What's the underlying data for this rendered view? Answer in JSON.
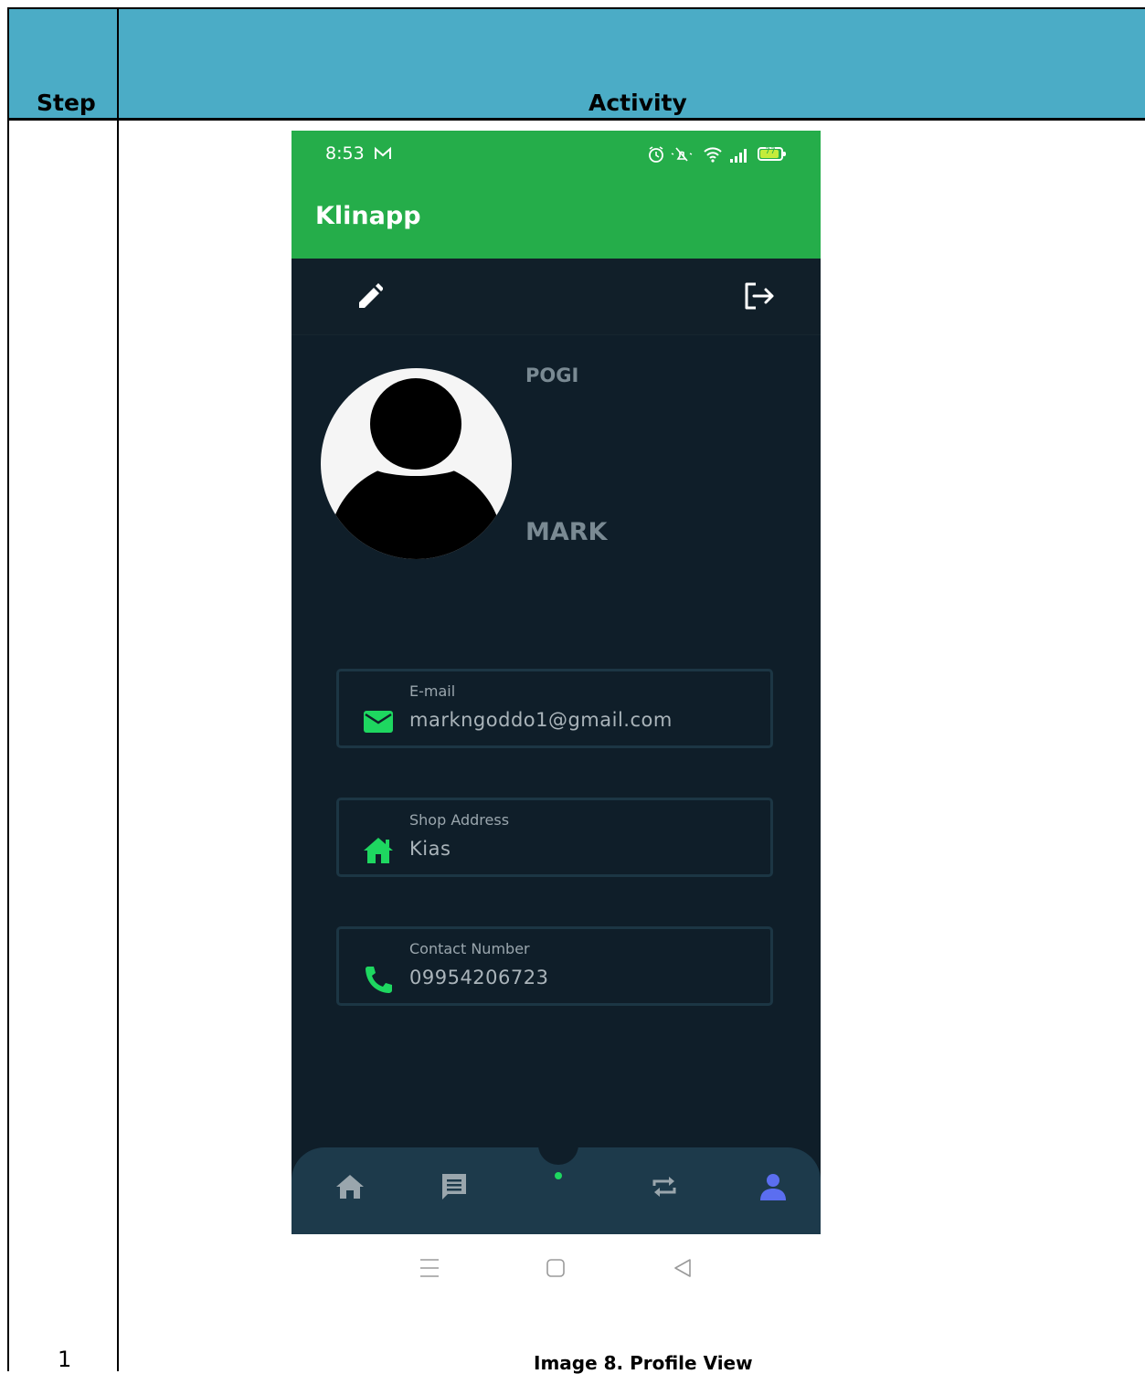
{
  "document": {
    "header": {
      "step": "Step",
      "activity": "Activity"
    },
    "step_number": "1",
    "caption": "Image 8. Profile View"
  },
  "status_bar": {
    "time": "8:53",
    "battery_level": "77",
    "icons": [
      "gmail-icon",
      "alarm-icon",
      "mute-icon",
      "wifi-icon",
      "signal-icon",
      "battery-icon"
    ]
  },
  "app": {
    "title": "Klinapp",
    "colors": {
      "appbar": "#25ad4a",
      "background": "#0f1e29",
      "accent_icon": "#1ed760",
      "active_nav": "#5b6ef0"
    }
  },
  "toolbar": {
    "edit_icon": "pencil-icon",
    "logout_icon": "logout-icon"
  },
  "profile": {
    "first_name": "POGI",
    "last_name": "MARK",
    "fields": [
      {
        "label": "E-mail",
        "value": "markngoddo1@gmail.com",
        "icon": "mail-icon"
      },
      {
        "label": "Shop Address",
        "value": "Kias",
        "icon": "home-icon"
      },
      {
        "label": "Contact Number",
        "value": "09954206723",
        "icon": "phone-icon"
      }
    ]
  },
  "bottom_nav": {
    "items": [
      {
        "name": "home",
        "icon": "home-icon",
        "active": false
      },
      {
        "name": "messages",
        "icon": "message-icon",
        "active": false
      },
      {
        "name": "center",
        "icon": "dot-icon",
        "active": false
      },
      {
        "name": "transactions",
        "icon": "repeat-icon",
        "active": false
      },
      {
        "name": "profile",
        "icon": "person-icon",
        "active": true
      }
    ]
  },
  "system_nav": {
    "icons": [
      "menu-icon",
      "square-icon",
      "back-icon"
    ]
  }
}
